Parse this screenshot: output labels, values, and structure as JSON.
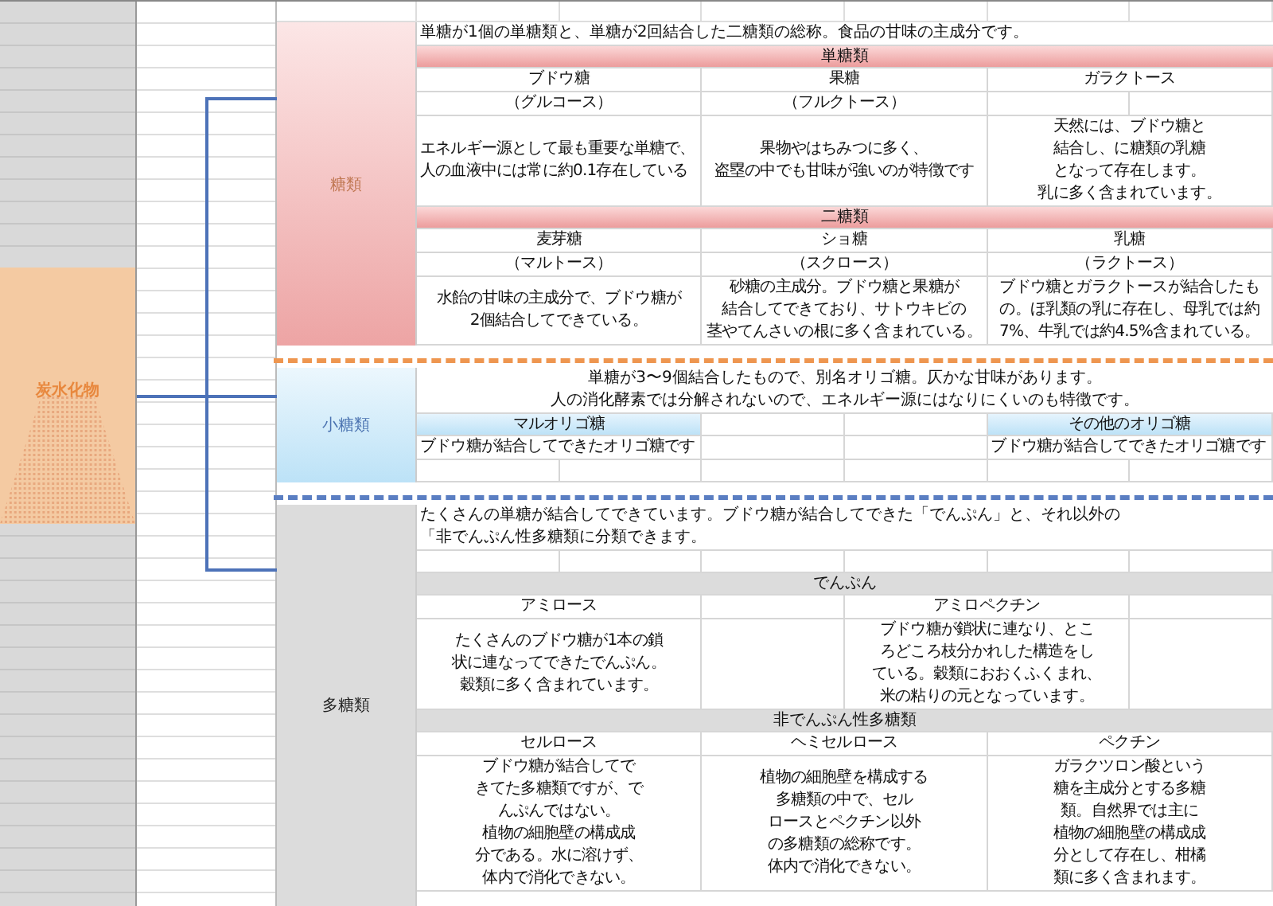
{
  "sheet": {
    "category": {
      "label": "炭水化物"
    },
    "groups": [
      {
        "label": "糖類",
        "kind": "sugar",
        "rows": [
          {
            "kind": "note",
            "lines": [
              "単糖が1個の単糖類と、単糖が2回結合した二糖類の総称。食品の甘味の主成分です。"
            ]
          },
          {
            "kind": "band",
            "text": "単糖類"
          },
          {
            "kind": "cells",
            "cells": [
              {
                "kind": "center",
                "wide": true,
                "lines": [
                  "ブドウ糖"
                ]
              },
              {
                "kind": "center",
                "wide": true,
                "lines": [
                  "果糖"
                ]
              },
              {
                "kind": "center",
                "wide": true,
                "lines": [
                  "ガラクトース"
                ]
              }
            ]
          },
          {
            "kind": "cells",
            "cells": [
              {
                "kind": "center",
                "wide": true,
                "lines": [
                  "（グルコース）"
                ]
              },
              {
                "kind": "center",
                "wide": true,
                "lines": [
                  "（フルクトース）"
                ]
              },
              {
                "kind": "blank",
                "wide": false
              },
              {
                "kind": "blank",
                "wide": false
              }
            ]
          },
          {
            "kind": "cells",
            "cells": [
              {
                "kind": "left",
                "wide": true,
                "lines": [
                  "エネルギー源として最も重要な単糖で、",
                  "人の血液中には常に約0.1存在している"
                ]
              },
              {
                "kind": "center",
                "wide": true,
                "lines": [
                  "果物やはちみつに多く、",
                  "盗塁の中でも甘味が強いのが特徴です"
                ]
              },
              {
                "kind": "center",
                "wide": true,
                "lines": [
                  "天然には、ブドウ糖と",
                  "結合し、に糖類の乳糖",
                  "となって存在します。",
                  "乳に多く含まれています。"
                ]
              }
            ]
          },
          {
            "kind": "band",
            "text": "二糖類"
          },
          {
            "kind": "cells",
            "cells": [
              {
                "kind": "center",
                "wide": true,
                "lines": [
                  "麦芽糖"
                ]
              },
              {
                "kind": "center",
                "wide": true,
                "lines": [
                  "ショ糖"
                ]
              },
              {
                "kind": "center",
                "wide": true,
                "lines": [
                  "乳糖"
                ]
              }
            ]
          },
          {
            "kind": "cells",
            "cells": [
              {
                "kind": "center",
                "wide": true,
                "lines": [
                  "（マルトース）"
                ]
              },
              {
                "kind": "center",
                "wide": true,
                "lines": [
                  "（スクロース）"
                ]
              },
              {
                "kind": "center",
                "wide": true,
                "lines": [
                  "（ラクトース）"
                ]
              }
            ]
          },
          {
            "kind": "cells",
            "cells": [
              {
                "kind": "center",
                "wide": true,
                "lines": [
                  "水飴の甘味の主成分で、ブドウ糖が",
                  "2個結合してできている。"
                ]
              },
              {
                "kind": "center",
                "wide": true,
                "lines": [
                  "砂糖の主成分。ブドウ糖と果糖が",
                  "結合してできており、サトウキビの",
                  "茎やてんさいの根に多く含まれている。"
                ]
              },
              {
                "kind": "center",
                "wide": true,
                "lines": [
                  "ブドウ糖とガラクトースが結合したも",
                  "の。ほ乳類の乳に存在し、母乳では約",
                  "7%、牛乳では約4.5%含まれている。"
                ]
              }
            ]
          }
        ]
      },
      {
        "label": "小糖類",
        "kind": "oligo",
        "rows": [
          {
            "kind": "caption",
            "lines": [
              "単糖が3〜9個結合したもので、別名オリゴ糖。仄かな甘味があります。",
              "人の消化酵素では分解されないので、エネルギー源にはなりにくいのも特徴です。"
            ]
          },
          {
            "kind": "cells",
            "cells": [
              {
                "kind": "band",
                "wide": true,
                "lines": [
                  "マルオリゴ糖"
                ]
              },
              {
                "kind": "blank",
                "wide": false
              },
              {
                "kind": "blank",
                "wide": false
              },
              {
                "kind": "band",
                "wide": true,
                "lines": [
                  "その他のオリゴ糖"
                ]
              }
            ]
          },
          {
            "kind": "cells",
            "cells": [
              {
                "kind": "left",
                "wide": true,
                "lines": [
                  "ブドウ糖が結合してできたオリゴ糖です"
                ]
              },
              {
                "kind": "blank",
                "wide": false
              },
              {
                "kind": "blank",
                "wide": false
              },
              {
                "kind": "left",
                "wide": true,
                "lines": [
                  "ブドウ糖が結合してできたオリゴ糖です"
                ]
              }
            ]
          },
          {
            "kind": "cells",
            "cells": [
              {
                "kind": "blank",
                "wide": false
              },
              {
                "kind": "blank",
                "wide": false
              },
              {
                "kind": "blank",
                "wide": false
              },
              {
                "kind": "blank",
                "wide": false
              },
              {
                "kind": "blank",
                "wide": false
              },
              {
                "kind": "blank",
                "wide": false
              }
            ]
          }
        ]
      },
      {
        "label": "多糖類",
        "kind": "poly",
        "rows": [
          {
            "kind": "note",
            "lines": [
              "たくさんの単糖が結合してできています。ブドウ糖が結合してできた「でんぷん」と、それ以外の",
              "「非でんぷん性多糖類に分類できます。"
            ]
          },
          {
            "kind": "cells",
            "cells": [
              {
                "kind": "blank",
                "wide": false
              },
              {
                "kind": "blank",
                "wide": false
              },
              {
                "kind": "blank",
                "wide": false
              },
              {
                "kind": "blank",
                "wide": false
              },
              {
                "kind": "blank",
                "wide": false
              },
              {
                "kind": "blank",
                "wide": false
              }
            ]
          },
          {
            "kind": "band",
            "text": "でんぷん"
          },
          {
            "kind": "cells",
            "cells": [
              {
                "kind": "center",
                "wide": true,
                "lines": [
                  "アミロース"
                ]
              },
              {
                "kind": "blank",
                "wide": false
              },
              {
                "kind": "center",
                "wide": true,
                "lines": [
                  "アミロペクチン"
                ]
              },
              {
                "kind": "blank",
                "wide": false
              }
            ]
          },
          {
            "kind": "cells",
            "cells": [
              {
                "kind": "center",
                "wide": true,
                "lines": [
                  "たくさんのブドウ糖が1本の鎖",
                  "状に連なってできたでんぷん。",
                  "穀類に多く含まれています。"
                ]
              },
              {
                "kind": "blank",
                "wide": false
              },
              {
                "kind": "center",
                "wide": true,
                "lines": [
                  "ブドウ糖が鎖状に連なり、とこ",
                  "ろどころ枝分かれした構造をし",
                  "ている。穀類におおくふくまれ、",
                  "米の粘りの元となっています。"
                ]
              },
              {
                "kind": "blank",
                "wide": false
              }
            ]
          },
          {
            "kind": "band",
            "text": "非でんぷん性多糖類"
          },
          {
            "kind": "cells",
            "cells": [
              {
                "kind": "center",
                "wide": true,
                "lines": [
                  "セルロース"
                ]
              },
              {
                "kind": "center",
                "wide": true,
                "lines": [
                  "ヘミセルロース"
                ]
              },
              {
                "kind": "center",
                "wide": true,
                "lines": [
                  "ペクチン"
                ]
              }
            ]
          },
          {
            "kind": "cells",
            "cells": [
              {
                "kind": "center",
                "wide": true,
                "lines": [
                  "ブドウ糖が結合してで",
                  "きてた多糖類ですが、で",
                  "んぷんではない。",
                  "植物の細胞壁の構成成",
                  "分である。水に溶けず、",
                  "体内で消化できない。"
                ]
              },
              {
                "kind": "center",
                "wide": true,
                "lines": [
                  "植物の細胞壁を構成する",
                  "多糖類の中で、セル",
                  "ロースとペクチン以外",
                  "の多糖類の総称です。",
                  "体内で消化できない。"
                ]
              },
              {
                "kind": "center",
                "wide": true,
                "lines": [
                  "ガラクツロン酸という",
                  "糖を主成分とする多糖",
                  "類。自然界では主に",
                  "植物の細胞壁の構成成",
                  "分として存在し、柑橘",
                  "類に多く含まれます。"
                ]
              }
            ]
          }
        ]
      }
    ]
  }
}
